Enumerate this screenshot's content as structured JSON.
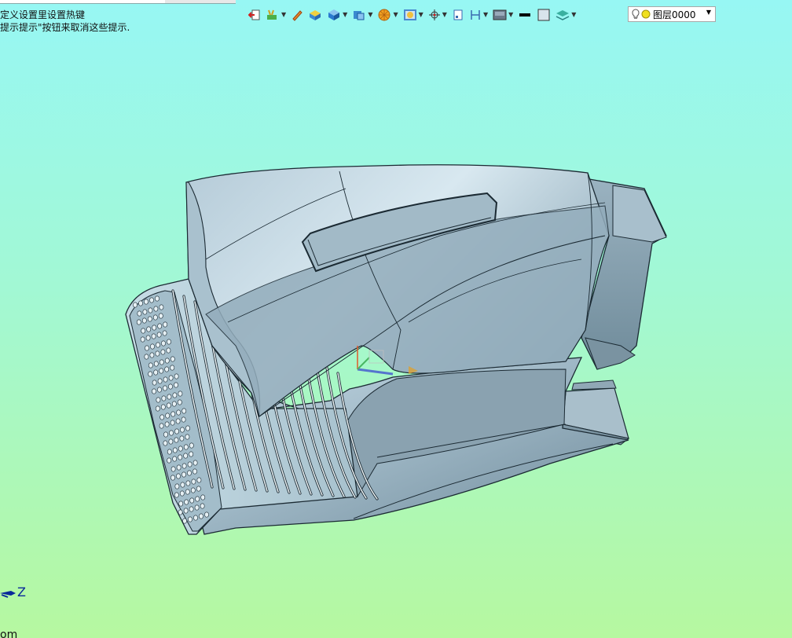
{
  "app": {
    "hint_line1": "定义设置里设置热键",
    "hint_line2": "提示提示\"按钮来取消这些提示."
  },
  "toolbar": {
    "buttons": [
      {
        "icon": "exit-sketch-icon"
      },
      {
        "icon": "view-orient-icon",
        "dropdown": true
      },
      {
        "icon": "pencil-icon"
      },
      {
        "icon": "yellow-box-icon"
      },
      {
        "icon": "blue-cube-icon",
        "dropdown": true
      },
      {
        "icon": "display-mode-icon",
        "dropdown": true
      },
      {
        "icon": "render-sphere-icon",
        "dropdown": true
      },
      {
        "icon": "section-view-icon",
        "dropdown": true
      },
      {
        "icon": "crosshair-icon",
        "dropdown": true
      },
      {
        "icon": "page-icon"
      },
      {
        "icon": "dimension-icon",
        "dropdown": true
      },
      {
        "icon": "background-icon",
        "dropdown": true
      },
      {
        "icon": "line-color-icon"
      },
      {
        "icon": "fill-color-icon"
      },
      {
        "icon": "layer-manager-icon",
        "dropdown": true
      }
    ],
    "layer_select": {
      "value": "图层0000"
    }
  },
  "colors": {
    "bg_top": "#97f7f4",
    "bg_bottom": "#b6f8a0",
    "model_body": "#8aa8b8",
    "axis_blue": "#0a2a9a"
  },
  "viewport": {
    "axis_label": "Z",
    "bottom_text": "om"
  }
}
